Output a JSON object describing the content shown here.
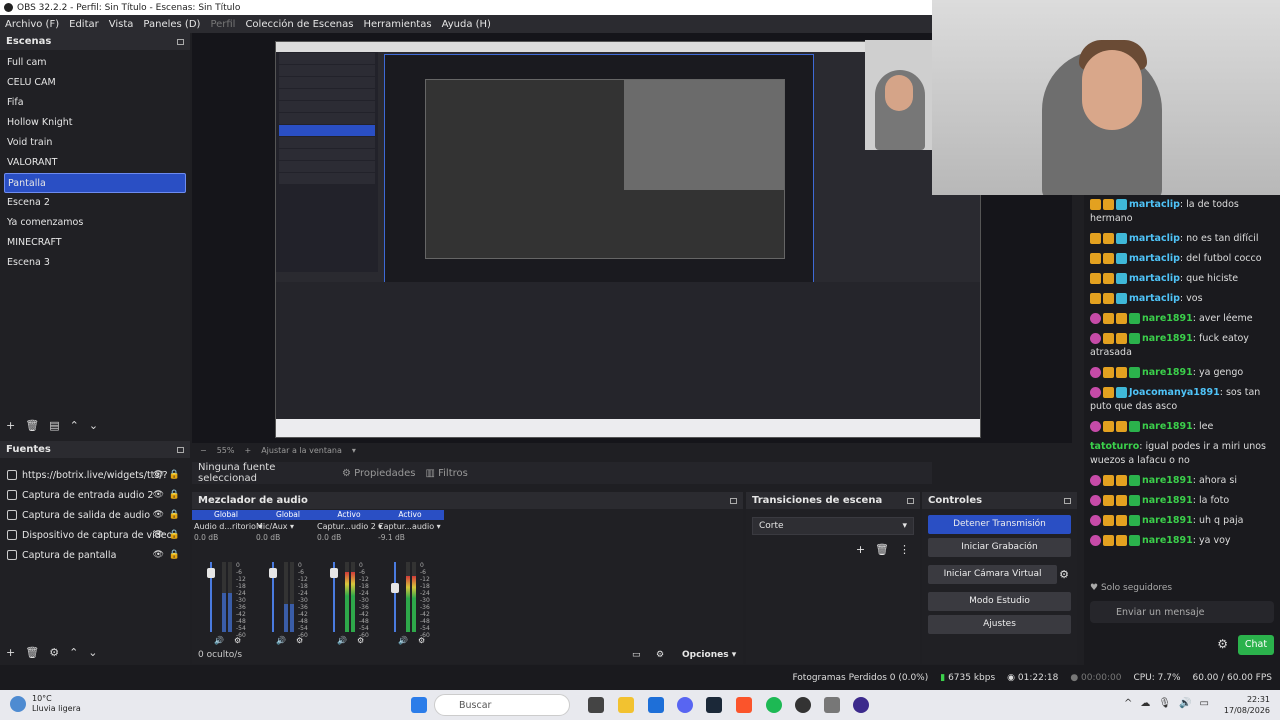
{
  "window": {
    "title": "OBS 32.2.2 - Perfil: Sin Título - Escenas: Sin Título"
  },
  "menu": [
    "Archivo (F)",
    "Editar",
    "Vista",
    "Paneles (D)",
    "Perfil",
    "Colección de Escenas",
    "Herramientas",
    "Ayuda (H)"
  ],
  "scenes": {
    "title": "Escenas",
    "items": [
      "Full cam",
      "CELU CAM",
      "Fifa",
      "Hollow Knight",
      "Void train",
      "VALORANT",
      "Pantalla",
      "Escena 2",
      "Ya comenzamos",
      "MINECRAFT",
      "Escena 3"
    ],
    "selected": "Pantalla"
  },
  "sources": {
    "title": "Fuentes",
    "items": [
      {
        "label": "https://botrix.live/widgets/tts/?",
        "icon": "globe-icon"
      },
      {
        "label": "Captura de entrada audio 2",
        "icon": "mic-icon"
      },
      {
        "label": "Captura de salida de audio",
        "icon": "speaker-icon"
      },
      {
        "label": "Dispositivo de captura de vídeo",
        "icon": "camera-icon"
      },
      {
        "label": "Captura de pantalla",
        "icon": "monitor-icon"
      }
    ]
  },
  "preview": {
    "zoom": "55%",
    "fit": "Ajustar a la ventana"
  },
  "properties": {
    "no_source": "Ninguna fuente seleccionad",
    "properties_label": "Propiedades",
    "filters_label": "Filtros"
  },
  "mixer": {
    "title": "Mezclador de audio",
    "channels": [
      {
        "tag": "Global",
        "name": "Audio d...ritorio",
        "db": "0.0 dB",
        "level": 0.55,
        "fader": 0.1
      },
      {
        "tag": "Global",
        "name": "Mic/Aux",
        "db": "0.0 dB",
        "level": 0.4,
        "fader": 0.1
      },
      {
        "tag": "Activo",
        "name": "Captur...udio 2",
        "db": "0.0 dB",
        "level": 0.85,
        "fader": 0.1
      },
      {
        "tag": "Activo",
        "name": "Captur...audio",
        "db": "-9.1 dB",
        "level": 0.8,
        "fader": 0.35
      }
    ],
    "scale": [
      "0",
      "-6",
      "-12",
      "-18",
      "-24",
      "-30",
      "-36",
      "-42",
      "-48",
      "-54",
      "-60"
    ],
    "hidden": "0 oculto/s",
    "options": "Opciones"
  },
  "transitions": {
    "title": "Transiciones de escena",
    "selected": "Corte"
  },
  "controls": {
    "title": "Controles",
    "buttons": [
      "Detener Transmisión",
      "Iniciar Grabación",
      "Iniciar Cámara Virtual",
      "Modo Estudio",
      "Ajustes"
    ]
  },
  "status": {
    "dropped": "Fotogramas Perdidos 0 (0.0%)",
    "bitrate": "6735 kbps",
    "stream_time": "01:22:18",
    "rec_time": "00:00:00",
    "cpu": "CPU: 7.7%",
    "fps": "60.00 / 60.00 FPS"
  },
  "chat": {
    "messages": [
      {
        "user": "martaclip",
        "text": "la de todos hermano",
        "color": "#4fc3f7",
        "badges": [
          "b-org",
          "b-org",
          "b-cyan"
        ]
      },
      {
        "user": "martaclip",
        "text": "no es tan difícil",
        "color": "#4fc3f7",
        "badges": [
          "b-org",
          "b-org",
          "b-cyan"
        ]
      },
      {
        "user": "martaclip",
        "text": "del futbol cocco",
        "color": "#4fc3f7",
        "badges": [
          "b-org",
          "b-org",
          "b-cyan"
        ]
      },
      {
        "user": "martaclip",
        "text": "que hiciste",
        "color": "#4fc3f7",
        "badges": [
          "b-org",
          "b-org",
          "b-cyan"
        ]
      },
      {
        "user": "martaclip",
        "text": "vos",
        "color": "#4fc3f7",
        "badges": [
          "b-org",
          "b-org",
          "b-cyan"
        ]
      },
      {
        "user": "nare1891",
        "text": "aver léeme",
        "color": "#3bd04b",
        "badges": [
          "b-pink",
          "b-org",
          "b-org",
          "b-grn"
        ]
      },
      {
        "user": "nare1891",
        "text": "fuck eatoy atrasada",
        "color": "#3bd04b",
        "badges": [
          "b-pink",
          "b-org",
          "b-org",
          "b-grn"
        ]
      },
      {
        "user": "nare1891",
        "text": "ya gengo",
        "color": "#3bd04b",
        "badges": [
          "b-pink",
          "b-org",
          "b-org",
          "b-grn"
        ]
      },
      {
        "user": "Joacomanya1891",
        "text": "sos tan puto que das asco",
        "color": "#4fc3f7",
        "badges": [
          "b-pink",
          "b-org",
          "b-cyan"
        ]
      },
      {
        "user": "nare1891",
        "text": "lee",
        "color": "#3bd04b",
        "badges": [
          "b-pink",
          "b-org",
          "b-org",
          "b-grn"
        ]
      },
      {
        "user": "tatoturro",
        "text": "igual podes ir a miri unos wuezos a lafacu o no",
        "color": "#3bd04b",
        "badges": []
      },
      {
        "user": "nare1891",
        "text": "ahora si",
        "color": "#3bd04b",
        "badges": [
          "b-pink",
          "b-org",
          "b-org",
          "b-grn"
        ]
      },
      {
        "user": "nare1891",
        "text": "la foto",
        "color": "#3bd04b",
        "badges": [
          "b-pink",
          "b-org",
          "b-org",
          "b-grn"
        ]
      },
      {
        "user": "nare1891",
        "text": "uh q paja",
        "color": "#3bd04b",
        "badges": [
          "b-pink",
          "b-org",
          "b-org",
          "b-grn"
        ]
      },
      {
        "user": "nare1891",
        "text": "ya voy",
        "color": "#3bd04b",
        "badges": [
          "b-pink",
          "b-org",
          "b-org",
          "b-grn"
        ]
      }
    ],
    "followers_only": "Solo seguidores",
    "placeholder": "Enviar un mensaje",
    "send_label": "Chat"
  },
  "taskbar": {
    "weather_temp": "10°C",
    "weather_desc": "Lluvia ligera",
    "search": "Buscar",
    "time": "22:31",
    "date": "17/08/2026"
  }
}
